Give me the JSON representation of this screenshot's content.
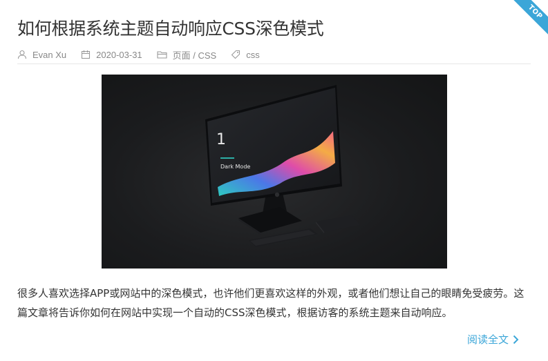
{
  "post": {
    "ribbon_label": "TOP",
    "title": "如何根据系统主题自动响应CSS深色模式",
    "meta": {
      "author": "Evan Xu",
      "date": "2020-03-31",
      "category": "页面 / CSS",
      "tag": "css"
    },
    "image": {
      "screen_number": "1",
      "screen_caption": "Dark Mode"
    },
    "excerpt": "很多人喜欢选择APP或网站中的深色模式，也许他们更喜欢这样的外观，或者他们想让自己的眼睛免受疲劳。这篇文章将告诉你如何在网站中实现一个自动的CSS深色模式，根据访客的系统主题来自动响应。",
    "read_more_label": "阅读全文"
  },
  "colors": {
    "accent": "#3ba6d8",
    "meta_text": "#888888",
    "title_text": "#333333"
  }
}
